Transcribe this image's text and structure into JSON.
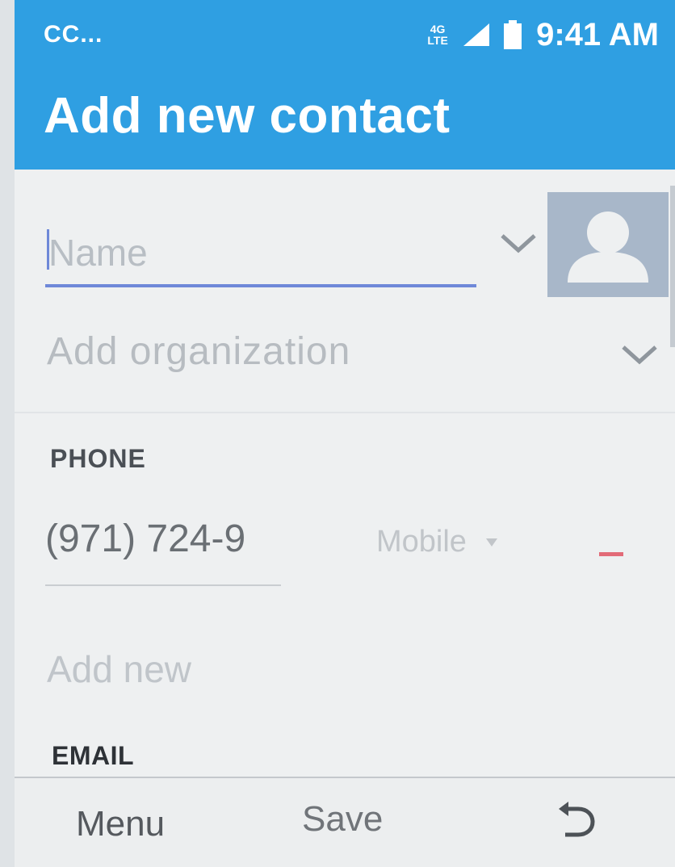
{
  "status_bar": {
    "left_text": "CC...",
    "network_type_top": "4G",
    "network_type_bottom": "LTE",
    "time": "9:41 AM",
    "icons": [
      "network-type-icon",
      "signal-icon",
      "battery-icon"
    ]
  },
  "app_bar": {
    "title": "Add new contact"
  },
  "form": {
    "name_placeholder": "Name",
    "name_value": "",
    "organization_placeholder": "Add organization",
    "phone_section_label": "PHONE",
    "phone_value": "(971) 724-9",
    "phone_type": "Mobile",
    "add_new_label": "Add new",
    "email_section_label": "EMAIL"
  },
  "soft_keys": {
    "left": "Menu",
    "center": "Save",
    "right_icon": "back-arrow-icon"
  },
  "colors": {
    "accent": "#2f9fe2",
    "underline_focus": "#6e88d8",
    "remove": "#e26b78",
    "avatar_bg": "#a8b7c9"
  }
}
